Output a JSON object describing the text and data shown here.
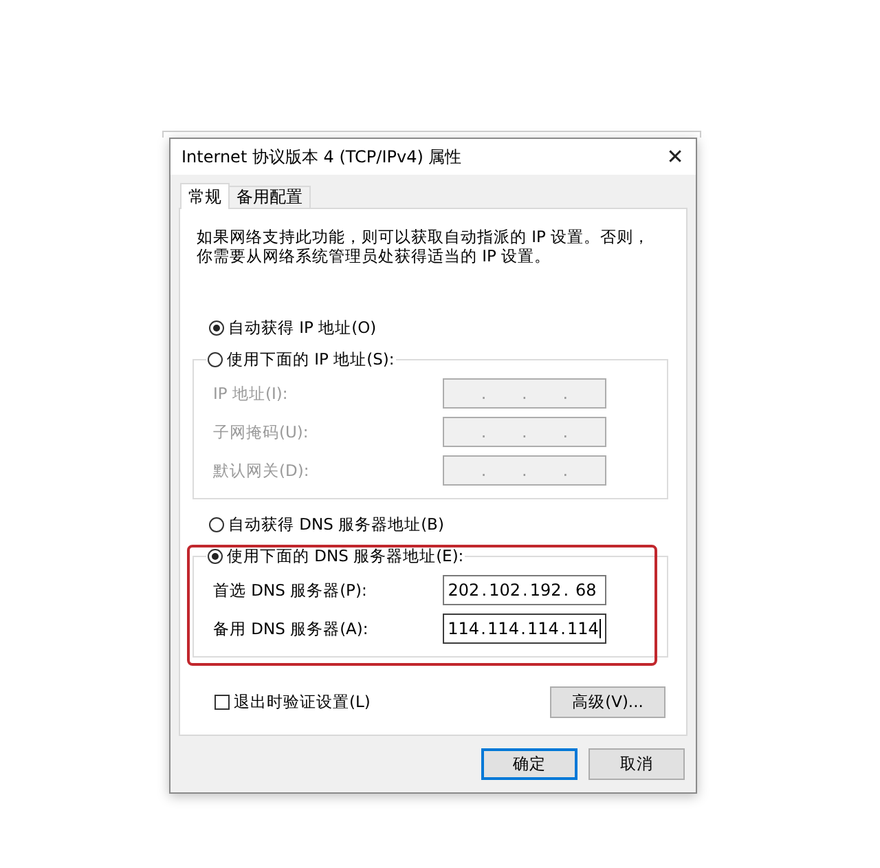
{
  "window": {
    "title": "Internet 协议版本 4 (TCP/IPv4) 属性",
    "close": "✕"
  },
  "tabs": [
    {
      "label": "常规",
      "selected": true
    },
    {
      "label": "备用配置",
      "selected": false
    }
  ],
  "description": "如果网络支持此功能，则可以获取自动指派的 IP 设置。否则，你需要从网络系统管理员处获得适当的 IP 设置。",
  "octet_separator": ".",
  "ip_section": {
    "auto_option": {
      "label": "自动获得 IP 地址(O)",
      "selected": true
    },
    "manual_option": {
      "label": "使用下面的 IP 地址(S):",
      "selected": false
    },
    "fields": [
      {
        "label": "IP 地址(I):",
        "disabled": true
      },
      {
        "label": "子网掩码(U):",
        "disabled": true
      },
      {
        "label": "默认网关(D):",
        "disabled": true
      }
    ]
  },
  "dns_section": {
    "auto_option": {
      "label": "自动获得 DNS 服务器地址(B)",
      "selected": false
    },
    "manual_option": {
      "label": "使用下面的 DNS 服务器地址(E):",
      "selected": true
    },
    "highlighted": true,
    "fields": [
      {
        "label": "首选 DNS 服务器(P):",
        "disabled": false,
        "focused": false,
        "octets": [
          "202",
          "102",
          "192",
          "68"
        ]
      },
      {
        "label": "备用 DNS 服务器(A):",
        "disabled": false,
        "focused": true,
        "octets": [
          "114",
          "114",
          "114",
          "114"
        ]
      }
    ]
  },
  "validate_checkbox": {
    "label": "退出时验证设置(L)",
    "checked": false
  },
  "advanced_button": "高级(V)...",
  "buttons": [
    {
      "label": "确定",
      "default": true
    },
    {
      "label": "取消",
      "default": false
    }
  ]
}
